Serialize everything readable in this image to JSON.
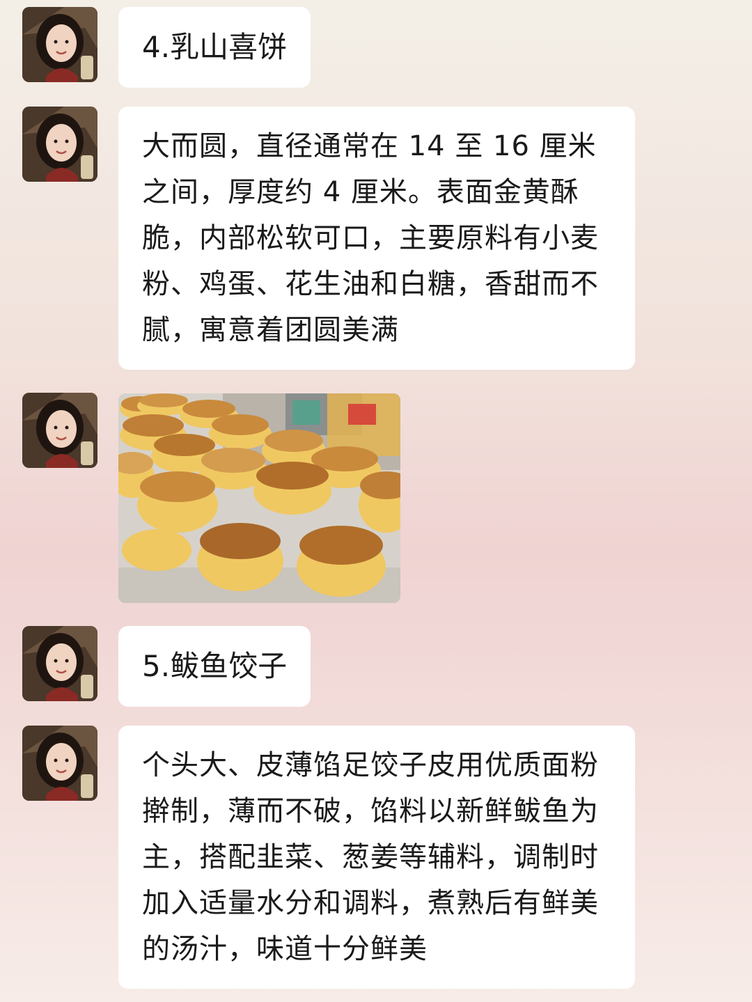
{
  "messages": [
    {
      "type": "text",
      "text": "4.乳山喜饼"
    },
    {
      "type": "text",
      "text": "大而圆，直径通常在 14 至 16 厘米之间，厚度约 4 厘米。表面金黄酥脆，内部松软可口，主要原料有小麦粉、鸡蛋、花生油和白糖，香甜而不腻，寓意着团圆美满"
    },
    {
      "type": "image",
      "image": "stacks-of-golden-round-cakes-photo"
    },
    {
      "type": "text",
      "text": "5.鲅鱼饺子"
    },
    {
      "type": "text",
      "text": "个头大、皮薄馅足饺子皮用优质面粉擀制，薄而不破，馅料以新鲜鲅鱼为主，搭配韭菜、葱姜等辅料，调制时加入适量水分和调料，煮熟后有鲜美的汤汁，味道十分鲜美"
    }
  ],
  "colors": {
    "bubble": "#ffffff",
    "text": "#1a1a1a",
    "cake_top": "#c98a3c",
    "cake_side": "#f0c862"
  }
}
